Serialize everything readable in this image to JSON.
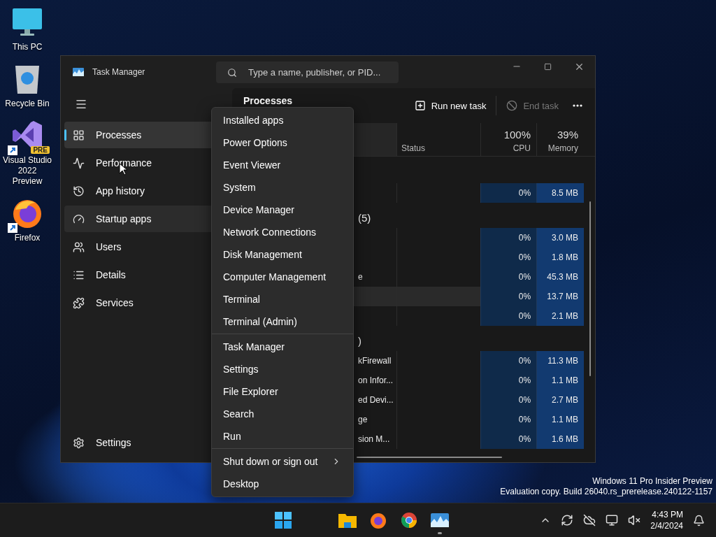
{
  "desktop_icons": [
    {
      "label": "This PC",
      "kind": "monitor",
      "shortcut": false
    },
    {
      "label": "Recycle Bin",
      "kind": "bin",
      "shortcut": false
    },
    {
      "label": "Visual Studio 2022 Preview",
      "kind": "studio",
      "badge": "PRE",
      "shortcut": true
    },
    {
      "label": "Firefox",
      "kind": "browser",
      "shortcut": true
    }
  ],
  "window": {
    "title": "Task Manager",
    "search": {
      "placeholder": "Type a name, publisher, or PID..."
    },
    "nav": [
      {
        "label": "Processes",
        "selected": true,
        "hovered": false
      },
      {
        "label": "Performance",
        "selected": false,
        "hovered": false
      },
      {
        "label": "App history",
        "selected": false,
        "hovered": false
      },
      {
        "label": "Startup apps",
        "selected": false,
        "hovered": true
      },
      {
        "label": "Users",
        "selected": false,
        "hovered": false
      },
      {
        "label": "Details",
        "selected": false,
        "hovered": false
      },
      {
        "label": "Services",
        "selected": false,
        "hovered": false
      }
    ],
    "settings": "Settings",
    "toolbar": {
      "title": "Processes",
      "actions": [
        {
          "label": "Run new task",
          "disabled": false
        },
        {
          "label": "End task",
          "disabled": true
        }
      ]
    },
    "columns": [
      {
        "label": "Status"
      },
      {
        "percent": "100%",
        "label": "CPU"
      },
      {
        "percent": "39%",
        "label": "Memory"
      }
    ],
    "rows": [
      {
        "kind": "group",
        "name": ""
      },
      {
        "kind": "process",
        "name": "",
        "cpu": "0%",
        "memory": "8.5 MB",
        "hovered": false
      },
      {
        "kind": "group",
        "name": "(5)"
      },
      {
        "kind": "process",
        "name": "",
        "cpu": "0%",
        "memory": "3.0 MB",
        "hovered": false
      },
      {
        "kind": "process",
        "name": "",
        "cpu": "0%",
        "memory": "1.8 MB",
        "hovered": false
      },
      {
        "kind": "process",
        "name": "e",
        "cpu": "0%",
        "memory": "45.3 MB",
        "hovered": false
      },
      {
        "kind": "process",
        "name": "",
        "cpu": "0%",
        "memory": "13.7 MB",
        "hovered": true
      },
      {
        "kind": "process",
        "name": "",
        "cpu": "0%",
        "memory": "2.1 MB",
        "hovered": false
      },
      {
        "kind": "group",
        "name": ")"
      },
      {
        "kind": "process",
        "name": "kFirewall",
        "cpu": "0%",
        "memory": "11.3 MB",
        "hovered": false
      },
      {
        "kind": "process",
        "name": "on Infor...",
        "cpu": "0%",
        "memory": "1.1 MB",
        "hovered": false
      },
      {
        "kind": "process",
        "name": "ed Devi...",
        "cpu": "0%",
        "memory": "2.7 MB",
        "hovered": false
      },
      {
        "kind": "process",
        "name": "ge",
        "cpu": "0%",
        "memory": "1.1 MB",
        "hovered": false
      },
      {
        "kind": "process",
        "name": "sion M...",
        "cpu": "0%",
        "memory": "1.6 MB",
        "hovered": false
      }
    ]
  },
  "context_menu": {
    "sections": [
      [
        {
          "label": "Installed apps",
          "submenu": false
        },
        {
          "label": "Power Options",
          "submenu": false
        },
        {
          "label": "Event Viewer",
          "submenu": false
        },
        {
          "label": "System",
          "submenu": false
        },
        {
          "label": "Device Manager",
          "submenu": false
        },
        {
          "label": "Network Connections",
          "submenu": false
        },
        {
          "label": "Disk Management",
          "submenu": false
        },
        {
          "label": "Computer Management",
          "submenu": false
        },
        {
          "label": "Terminal",
          "submenu": false
        },
        {
          "label": "Terminal (Admin)",
          "submenu": false
        }
      ],
      [
        {
          "label": "Task Manager",
          "submenu": false
        },
        {
          "label": "Settings",
          "submenu": false
        },
        {
          "label": "File Explorer",
          "submenu": false
        },
        {
          "label": "Search",
          "submenu": false
        },
        {
          "label": "Run",
          "submenu": false
        }
      ],
      [
        {
          "label": "Shut down or sign out",
          "submenu": true
        },
        {
          "label": "Desktop",
          "submenu": false
        }
      ]
    ]
  },
  "watermark": [
    "Windows 11 Pro Insider Preview",
    "Evaluation copy. Build 26040.rs_prerelease.240122-1157"
  ],
  "taskbar": {
    "apps": [
      {
        "kind": "start",
        "running": false
      },
      {
        "kind": "files",
        "running": false
      },
      {
        "kind": "firefox",
        "running": false
      },
      {
        "kind": "chrome",
        "running": false
      },
      {
        "kind": "taskmgr",
        "running": true
      }
    ],
    "time": "4:43 PM",
    "date": "2/4/2024"
  }
}
